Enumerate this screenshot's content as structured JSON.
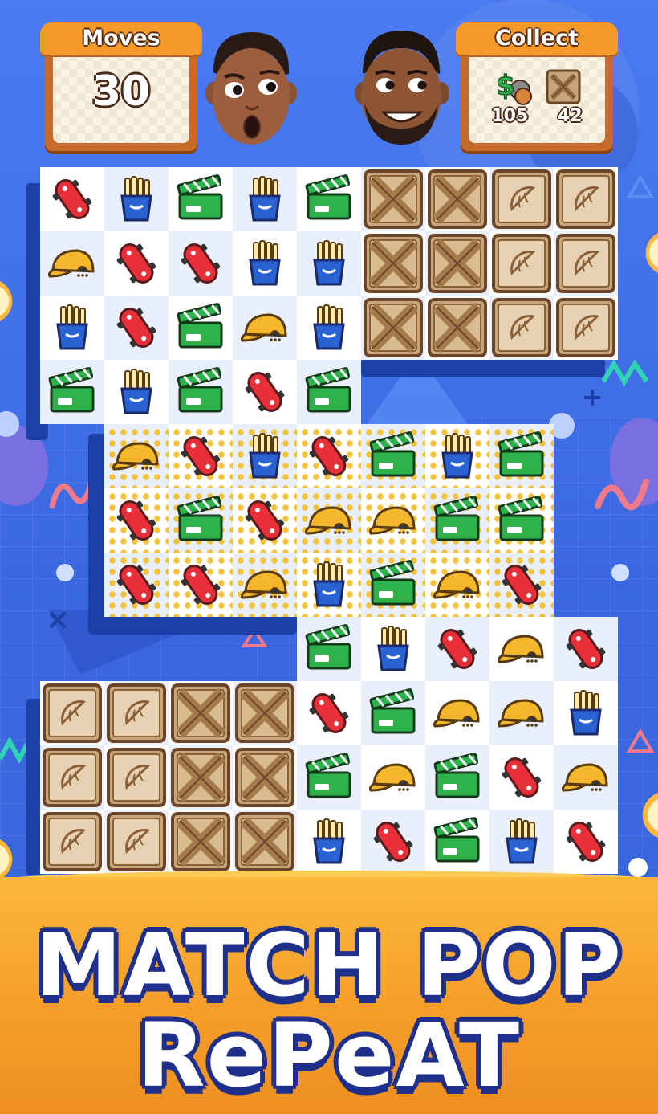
{
  "hud": {
    "moves": {
      "label": "Moves",
      "value": "30"
    },
    "collect": {
      "label": "Collect",
      "items": [
        {
          "icon": "money-coins-icon",
          "count": "105"
        },
        {
          "icon": "wooden-crate-icon",
          "count": "42"
        }
      ]
    }
  },
  "avatars": [
    {
      "icon": "surprised-face-avatar"
    },
    {
      "icon": "smiling-bearded-face-avatar"
    }
  ],
  "board": {
    "piece_types": [
      "skateboard-icon",
      "fries-icon",
      "clapperboard-icon",
      "cap-icon",
      "crate-icon",
      "lemon-tile-icon"
    ],
    "rows": [
      [
        "skateboard",
        "fries",
        "clapper",
        "fries",
        "clapper",
        "crate",
        "crate",
        "lemon",
        "lemon"
      ],
      [
        "cap",
        "skateboard",
        "skateboard",
        "fries",
        "fries",
        "crate",
        "crate",
        "lemon",
        "lemon"
      ],
      [
        "fries",
        "skateboard",
        "clapper",
        "cap",
        "fries",
        "crate",
        "crate",
        "lemon",
        "lemon"
      ],
      [
        "clapper",
        "fries",
        "clapper",
        "skateboard",
        "clapper",
        "",
        "",
        "",
        ""
      ],
      [
        "",
        "cap",
        "skateboard",
        "fries",
        "skateboard",
        "clapper",
        "fries",
        "clapper",
        ""
      ],
      [
        "",
        "skateboard",
        "clapper",
        "skateboard",
        "cap",
        "cap",
        "clapper",
        "clapper",
        ""
      ],
      [
        "",
        "skateboard",
        "skateboard",
        "cap",
        "fries",
        "clapper",
        "cap",
        "skateboard",
        ""
      ],
      [
        "",
        "",
        "",
        "",
        "clapper",
        "fries",
        "skateboard",
        "cap",
        "skateboard"
      ],
      [
        "lemon",
        "lemon",
        "crate",
        "crate",
        "skateboard",
        "clapper",
        "cap",
        "cap",
        "fries"
      ],
      [
        "lemon",
        "lemon",
        "crate",
        "crate",
        "clapper",
        "cap",
        "clapper",
        "skateboard",
        "cap"
      ],
      [
        "lemon",
        "lemon",
        "crate",
        "crate",
        "fries",
        "skateboard",
        "clapper",
        "fries",
        "skateboard"
      ]
    ],
    "dotted_rows": [
      4,
      5,
      6
    ]
  },
  "banner": {
    "line1": "MATCH POP",
    "line2": "RePeAT"
  },
  "colors": {
    "background": "#3f6fe6",
    "board_shadow": "#1d3fa8",
    "title_outline": "#1f2f8c",
    "sand": "#f5a02a"
  }
}
